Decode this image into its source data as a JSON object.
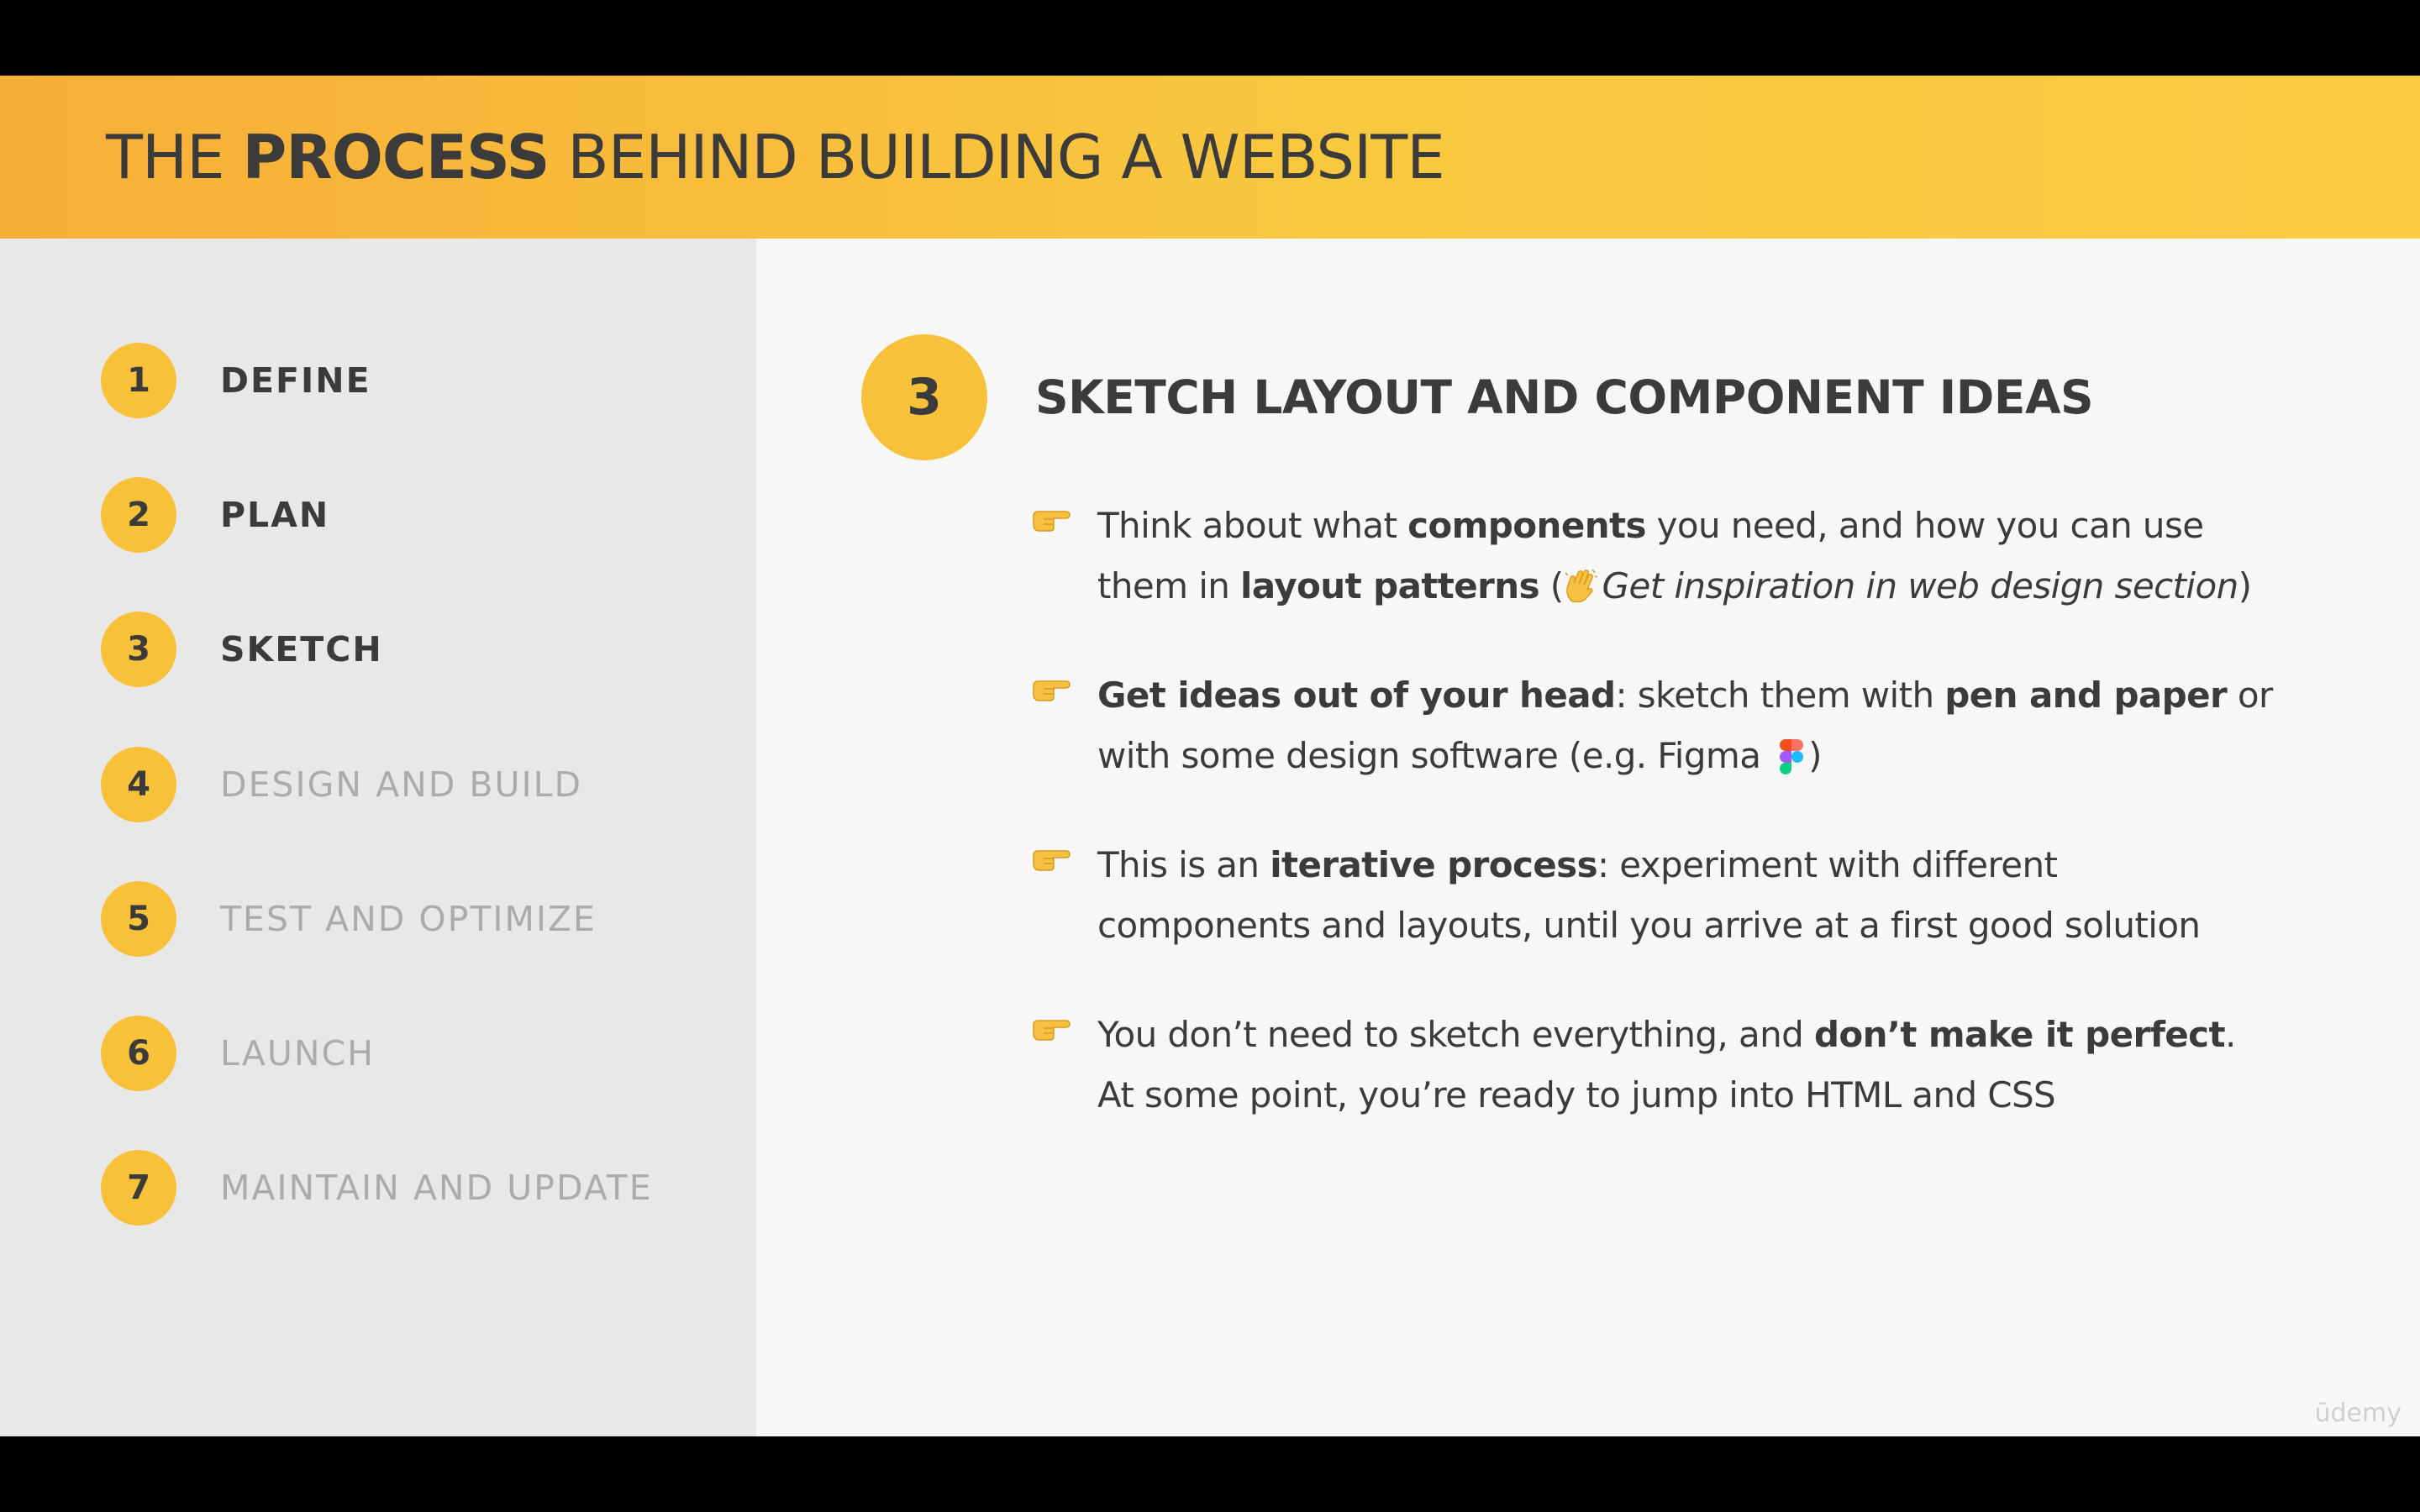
{
  "header": {
    "title_before": "THE ",
    "title_bold": "PROCESS",
    "title_after": " BEHIND BUILDING A WEBSITE"
  },
  "sidebar": {
    "steps": [
      {
        "number": "1",
        "label": "DEFINE",
        "state": "active"
      },
      {
        "number": "2",
        "label": "PLAN",
        "state": "active"
      },
      {
        "number": "3",
        "label": "SKETCH",
        "state": "active"
      },
      {
        "number": "4",
        "label": "DESIGN AND BUILD",
        "state": "inactive"
      },
      {
        "number": "5",
        "label": "TEST AND OPTIMIZE",
        "state": "inactive"
      },
      {
        "number": "6",
        "label": "LAUNCH",
        "state": "inactive"
      },
      {
        "number": "7",
        "label": "MAINTAIN AND UPDATE",
        "state": "inactive"
      }
    ]
  },
  "main": {
    "step_number": "3",
    "title": "SKETCH LAYOUT AND COMPONENT IDEAS",
    "bullets": [
      {
        "icon": "pointing-hand-icon",
        "line1": {
          "t1": "Think about what ",
          "b1": "components",
          "t2": " you need, and how you can use"
        },
        "line2": {
          "t1": "them in ",
          "b1": "layout patterns",
          "t2": " (",
          "emoji": "waving-hand-icon",
          "i1": "Get inspiration in web design section",
          "t3": ")"
        }
      },
      {
        "icon": "pointing-hand-icon",
        "line1": {
          "b1": "Get ideas out of your head",
          "t1": ": sketch them with ",
          "b2": "pen and paper",
          "t2": " or"
        },
        "line2": {
          "t1": "with some design software (e.g. Figma ",
          "emoji": "figma-logo-icon",
          "t2": ")"
        }
      },
      {
        "icon": "pointing-hand-icon",
        "line1": {
          "t1": "This is an ",
          "b1": "iterative process",
          "t2": ": experiment with different"
        },
        "line2": {
          "t1": "components and layouts, until you arrive at a first good solution"
        }
      },
      {
        "icon": "pointing-hand-icon",
        "line1": {
          "t1": "You don’t need to sketch everything, and ",
          "b1": "don’t make it perfect",
          "t2": "."
        },
        "line2": {
          "t1": "At some point, you’re ready to jump into HTML and CSS"
        }
      }
    ]
  },
  "watermark": "ūdemy",
  "colors": {
    "accent": "#f8c13a",
    "header_start": "#f7ae37",
    "header_end": "#f9cc42",
    "text": "#3b3b3b",
    "muted": "#ababab",
    "sidebar_bg": "#e8e8e8",
    "main_bg": "#f7f7f7"
  }
}
